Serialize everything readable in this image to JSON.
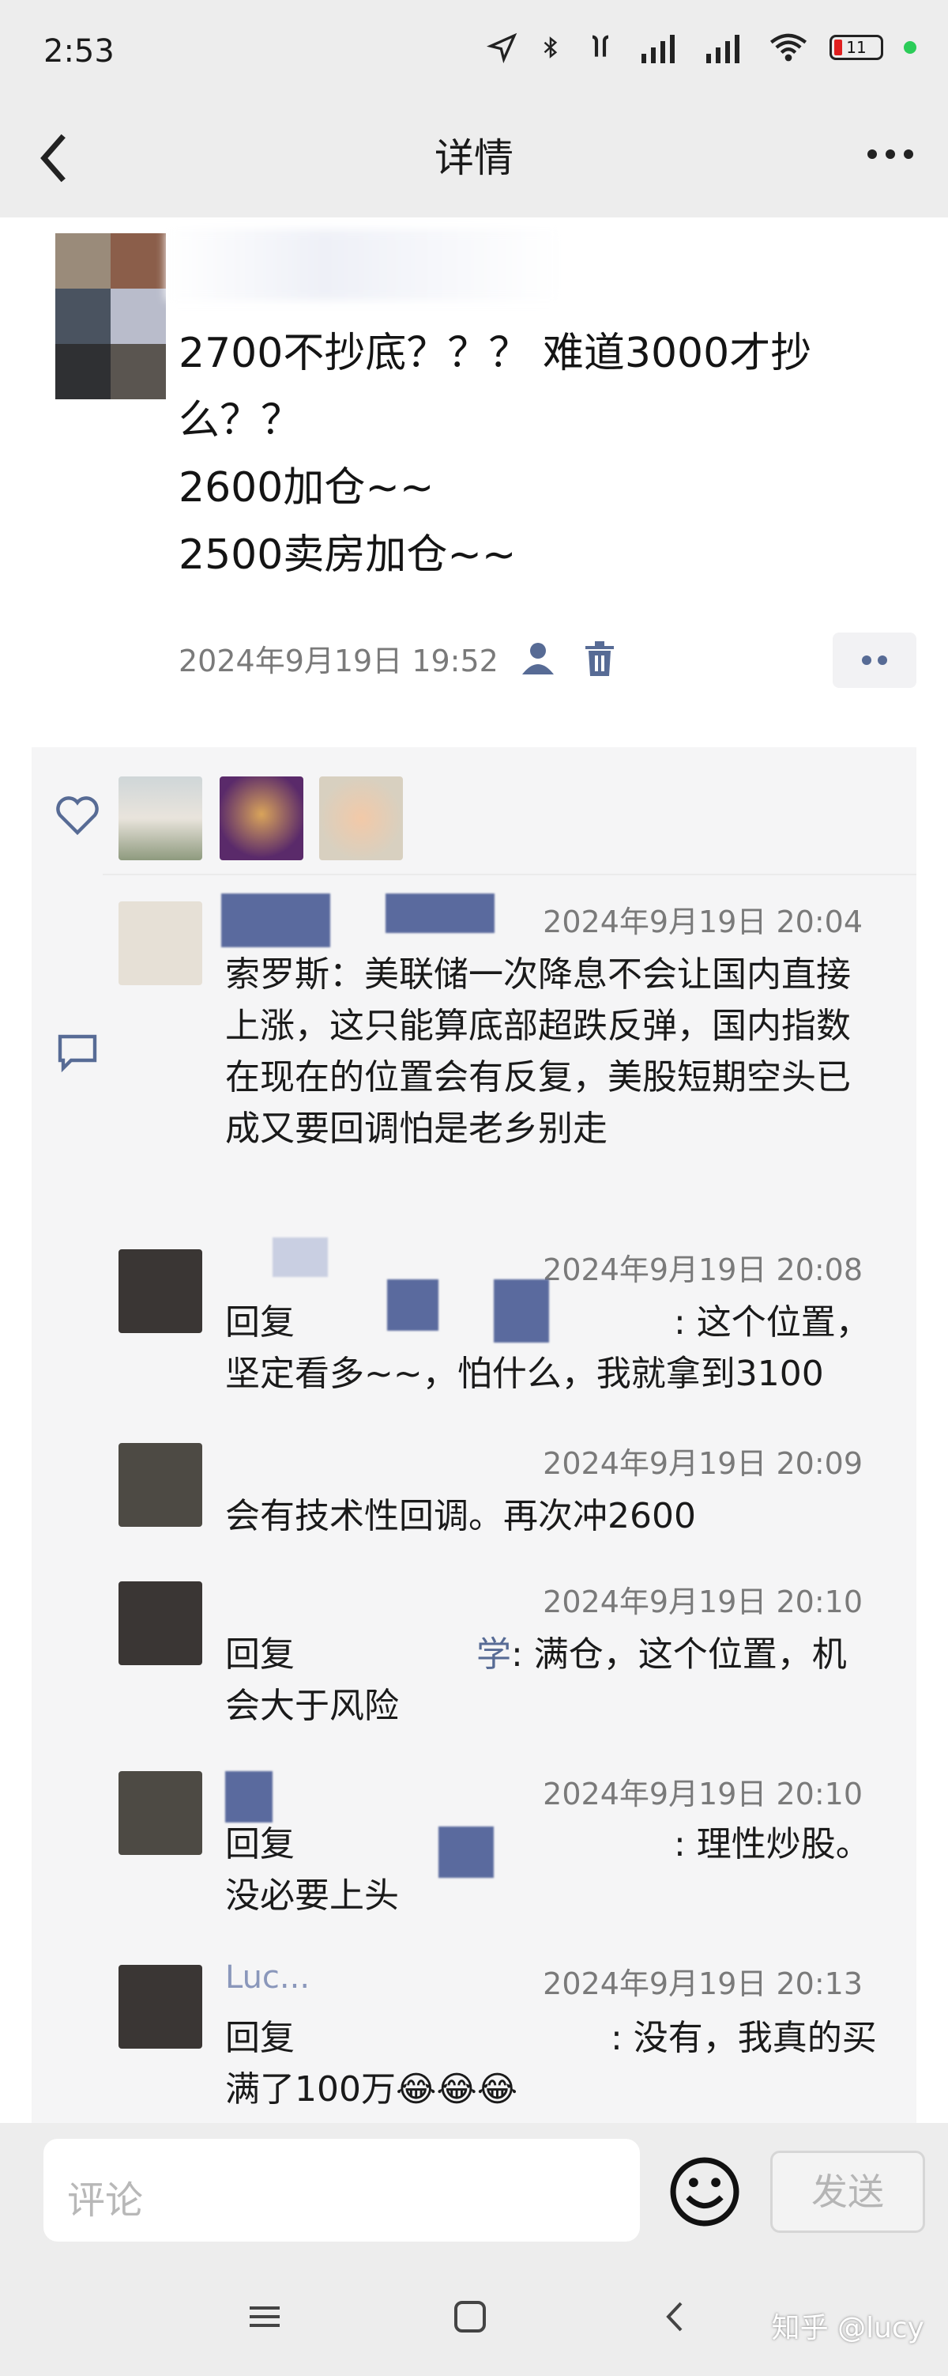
{
  "status_bar": {
    "time": "2:53",
    "battery": "11"
  },
  "nav": {
    "title": "详情"
  },
  "post": {
    "text": "2700不抄底？？？ 难道3000才抄\n么？？\n2600加仓~~\n2500卖房加仓~~",
    "date": "2024年9月19日 19:52"
  },
  "comments": [
    {
      "time": "2024年9月19日 20:04",
      "text": "索罗斯：美联储一次降息不会让国内直接上涨，这只能算底部超跌反弹，国内指数在现在的位置会有反复，美股短期空头已成又要回调怕是老乡别走"
    },
    {
      "time": "2024年9月19日 20:08",
      "prefix": "回复",
      "text": ": 这个位置，坚定看多~~，怕什么，我就拿到3100"
    },
    {
      "time": "2024年9月19日 20:09",
      "text": "会有技术性回调。再次冲2600"
    },
    {
      "time": "2024年9月19日 20:10",
      "prefix": "回复",
      "name_partial": "学",
      "text": ": 满仓，这个位置，机会大于风险"
    },
    {
      "time": "2024年9月19日 20:10",
      "prefix": "回复",
      "text": ": 理性炒股。没必要上头"
    },
    {
      "time": "2024年9月19日 20:13",
      "name_partial": "Luc...",
      "prefix": "回复",
      "text": ": 没有，我真的买满了100万😂😂😂"
    }
  ],
  "input": {
    "placeholder": "评论"
  },
  "send_label": "发送",
  "watermark": "知乎 @lucy",
  "colors": {
    "background": "#ffffff",
    "bar": "#ededed",
    "panel": "#f5f5f6",
    "accent_link": "#576b95"
  }
}
